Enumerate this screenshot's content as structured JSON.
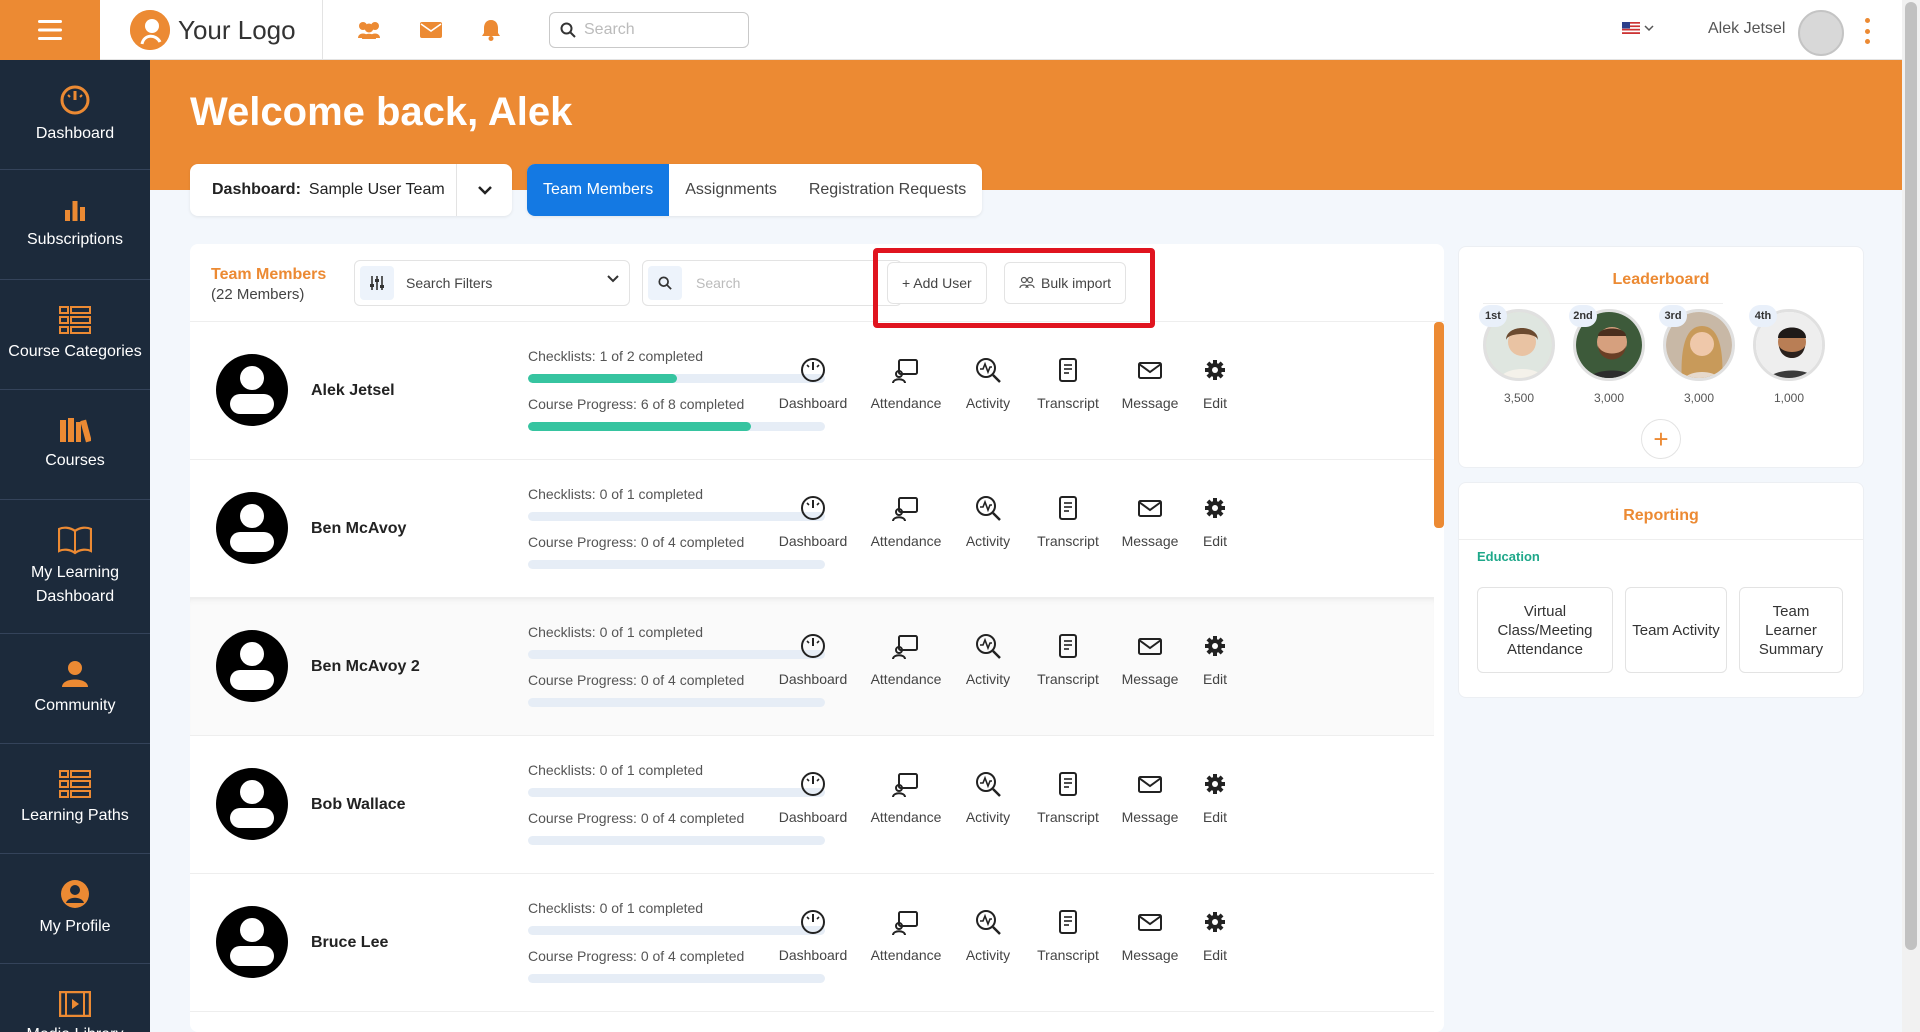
{
  "topbar": {
    "logo_text": "Your Logo",
    "search_placeholder": "Search",
    "user_name": "Alek Jetsel",
    "icons": [
      "people-icon",
      "mail-icon",
      "bell-icon"
    ]
  },
  "sidebar": {
    "items": [
      {
        "label": "Dashboard",
        "icon": "speedometer-icon"
      },
      {
        "label": "Subscriptions",
        "icon": "bar-chart-icon"
      },
      {
        "label": "Course Categories",
        "icon": "list-icon"
      },
      {
        "label": "Courses",
        "icon": "books-icon"
      },
      {
        "label": "My Learning Dashboard",
        "icon": "open-book-icon"
      },
      {
        "label": "Community",
        "icon": "community-icon"
      },
      {
        "label": "Learning Paths",
        "icon": "list-icon"
      },
      {
        "label": "My Profile",
        "icon": "user-circle-icon"
      },
      {
        "label": "Media Library",
        "icon": "film-icon"
      }
    ]
  },
  "hero": {
    "welcome": "Welcome back, Alek",
    "dashboard_label": "Dashboard:",
    "dashboard_value": "Sample User Team"
  },
  "tabs": [
    "Team Members",
    "Assignments",
    "Registration Requests"
  ],
  "members_panel": {
    "title": "Team Members",
    "count": "(22 Members)",
    "filters_label": "Search Filters",
    "search_placeholder": "Search",
    "add_user": "+ Add User",
    "bulk_import": "Bulk import",
    "actions": [
      "Dashboard",
      "Attendance",
      "Activity",
      "Transcript",
      "Message",
      "Edit"
    ],
    "members": [
      {
        "name": "Alek Jetsel",
        "checklists": "Checklists: 1 of 2 completed",
        "checklist_pct": 0.5,
        "course": "Course Progress: 6 of 8 completed",
        "course_pct": 0.75
      },
      {
        "name": "Ben McAvoy",
        "checklists": "Checklists: 0 of 1 completed",
        "checklist_pct": 0,
        "course": "Course Progress: 0 of 4 completed",
        "course_pct": 0
      },
      {
        "name": "Ben McAvoy 2",
        "checklists": "Checklists: 0 of 1 completed",
        "checklist_pct": 0,
        "course": "Course Progress: 0 of 4 completed",
        "course_pct": 0
      },
      {
        "name": "Bob Wallace",
        "checklists": "Checklists: 0 of 1 completed",
        "checklist_pct": 0,
        "course": "Course Progress: 0 of 4 completed",
        "course_pct": 0
      },
      {
        "name": "Bruce Lee",
        "checklists": "Checklists: 0 of 1 completed",
        "checklist_pct": 0,
        "course": "Course Progress: 0 of 4 completed",
        "course_pct": 0
      }
    ]
  },
  "leaderboard": {
    "title": "Leaderboard",
    "leaders": [
      {
        "rank": "1st",
        "points": "3,500"
      },
      {
        "rank": "2nd",
        "points": "3,000"
      },
      {
        "rank": "3rd",
        "points": "3,000"
      },
      {
        "rank": "4th",
        "points": "1,000"
      }
    ],
    "add_label": "+"
  },
  "reporting": {
    "title": "Reporting",
    "section": "Education",
    "tiles": [
      "Virtual Class/Meeting Attendance",
      "Team Activity",
      "Team Learner Summary"
    ]
  },
  "colors": {
    "brand": "#ec8a33",
    "tab_active": "#1479e3",
    "progress": "#36c4a0",
    "highlight": "#e0141f",
    "sidebar": "#1c2a3b"
  }
}
